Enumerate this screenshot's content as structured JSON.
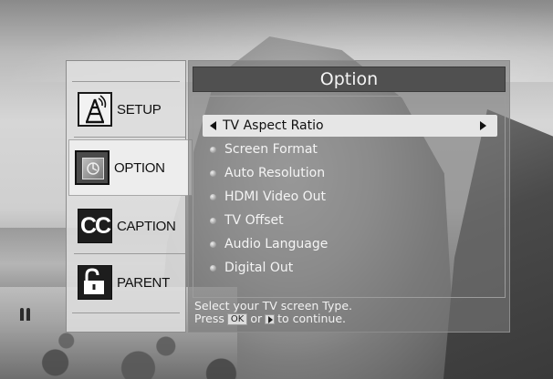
{
  "sidebar": {
    "items": [
      {
        "label": "SETUP",
        "icon": "antenna-icon"
      },
      {
        "label": "OPTION",
        "icon": "option-icon",
        "active": true
      },
      {
        "label": "CAPTION",
        "icon": "cc-icon",
        "icon_text": "CC"
      },
      {
        "label": "PARENT",
        "icon": "padlock-icon"
      }
    ]
  },
  "panel": {
    "title": "Option",
    "items": [
      {
        "label": "TV Aspect Ratio",
        "selected": true
      },
      {
        "label": "Screen Format"
      },
      {
        "label": "Auto Resolution"
      },
      {
        "label": "HDMI Video Out"
      },
      {
        "label": "TV Offset"
      },
      {
        "label": "Audio Language"
      },
      {
        "label": "Digital Out"
      }
    ]
  },
  "help": {
    "line1": "Select your TV screen Type.",
    "press": "Press",
    "ok_key": "OK",
    "or": "or",
    "continue": "to continue."
  }
}
